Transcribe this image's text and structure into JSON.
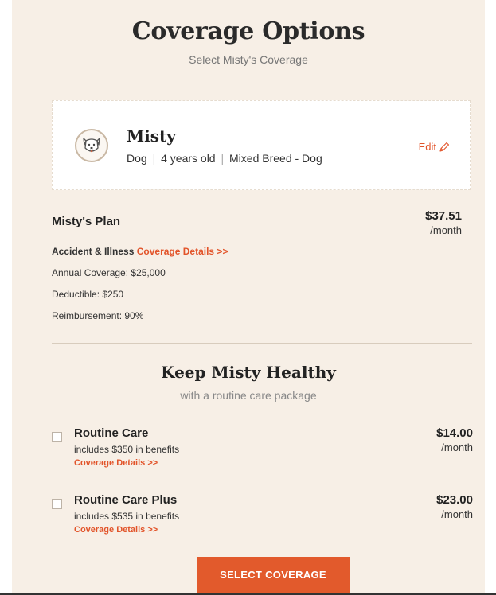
{
  "header": {
    "title": "Coverage Options",
    "subtitle": "Select Misty's Coverage"
  },
  "pet": {
    "name": "Misty",
    "species": "Dog",
    "age": "4 years old",
    "breed": "Mixed Breed - Dog",
    "separator": "|",
    "edit_label": "Edit",
    "avatar_icon": "dog-face-icon"
  },
  "plan": {
    "title": "Misty's Plan",
    "price": "$37.51",
    "per": "/month",
    "type": "Accident & Illness",
    "details_link": "Coverage Details >>",
    "annual_coverage": "Annual Coverage: $25,000",
    "deductible": "Deductible: $250",
    "reimbursement": "Reimbursement: 90%"
  },
  "routine": {
    "title": "Keep Misty Healthy",
    "subtitle": "with a routine care package",
    "packages": [
      {
        "name": "Routine Care",
        "benefit": "includes $350 in benefits",
        "link": "Coverage Details >>",
        "price": "$14.00",
        "per": "/month",
        "checked": false
      },
      {
        "name": "Routine Care Plus",
        "benefit": "includes $535 in benefits",
        "link": "Coverage Details >>",
        "price": "$23.00",
        "per": "/month",
        "checked": false
      }
    ]
  },
  "cta": {
    "label": "SELECT COVERAGE"
  },
  "colors": {
    "accent": "#e2542a",
    "background": "#f7efe6",
    "card": "#ffffff"
  }
}
